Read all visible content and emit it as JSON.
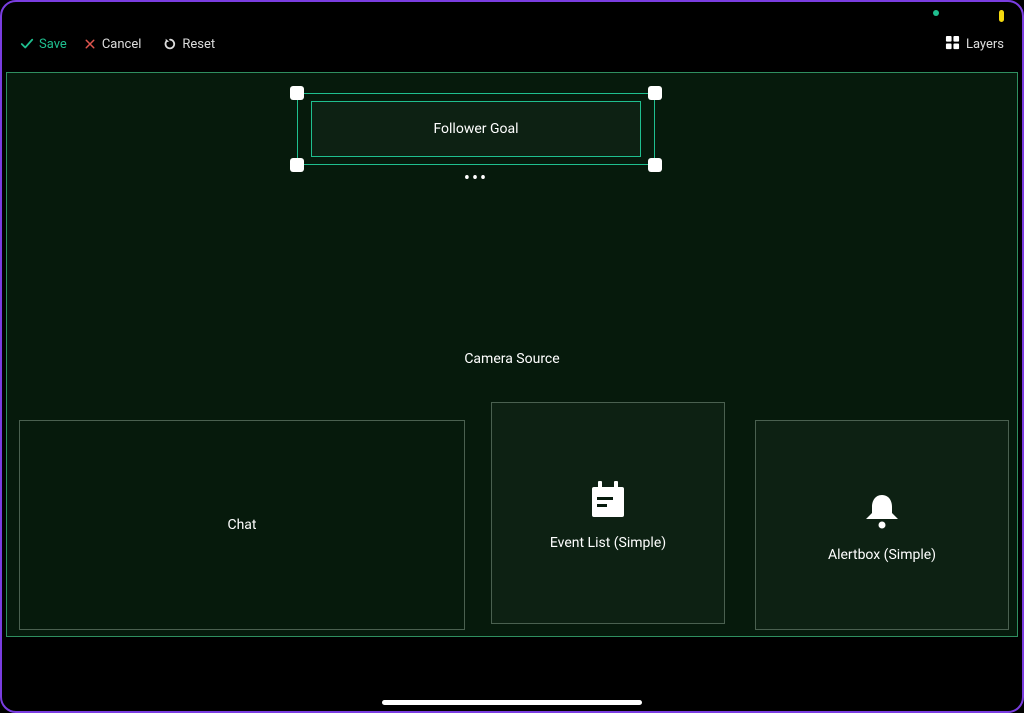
{
  "toolbar": {
    "save": "Save",
    "cancel": "Cancel",
    "reset": "Reset",
    "layers": "Layers"
  },
  "widgets": {
    "follower_goal": {
      "label": "Follower Goal",
      "selected": true
    },
    "camera_source": {
      "label": "Camera Source"
    },
    "chat": {
      "label": "Chat"
    },
    "event_list": {
      "label": "Event List (Simple)"
    },
    "alertbox": {
      "label": "Alertbox (Simple)"
    }
  },
  "colors": {
    "accent": "#1fbf8f",
    "frame": "#7a3de0",
    "canvas_bg": "#061a0c"
  }
}
